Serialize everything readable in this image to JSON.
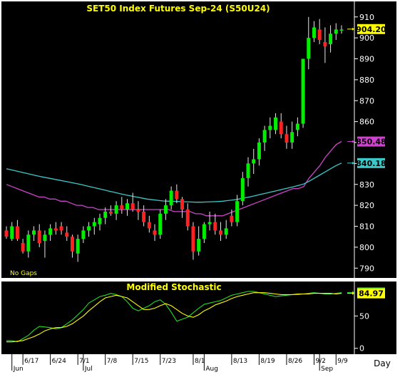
{
  "chart_data": [
    {
      "type": "candlestick",
      "title": "SET50  Index  Futures  Sep-24  (S50U24)",
      "note": "No Gaps",
      "ylim": [
        786,
        914
      ],
      "yticks": [
        790,
        800,
        810,
        820,
        830,
        840,
        850,
        860,
        870,
        880,
        890,
        900,
        910
      ],
      "last_price": {
        "value": "904.20",
        "color": "#ffff00"
      },
      "series": [
        {
          "name": "MA (magenta)",
          "color": "#cc44cc",
          "last": "850.48",
          "values": [
            830,
            829,
            828,
            827,
            826,
            825,
            824,
            824,
            823,
            823,
            822,
            822,
            821,
            820,
            820,
            819,
            819,
            818,
            818,
            818,
            818,
            818,
            818,
            818,
            818,
            818,
            818,
            818,
            818,
            818,
            818,
            817,
            817,
            817,
            817,
            816,
            816,
            815,
            815,
            815,
            815,
            816,
            817,
            818,
            819,
            820,
            821,
            822,
            823,
            824,
            825,
            826,
            827,
            828,
            828,
            829,
            833,
            836,
            839,
            843,
            846,
            849,
            850.5
          ]
        },
        {
          "name": "MA (cyan)",
          "color": "#3cc8c8",
          "last": "840.18",
          "values": [
            837.5,
            836.9,
            836.3,
            835.7,
            835.1,
            834.5,
            833.9,
            833.4,
            832.9,
            832.4,
            831.9,
            831.4,
            830.9,
            830.4,
            829.8,
            829.2,
            828.6,
            828,
            827.4,
            826.8,
            826.2,
            825.6,
            825,
            824.5,
            824,
            823.5,
            823,
            822.7,
            822.4,
            822.1,
            822,
            821.9,
            821.8,
            821.7,
            821.6,
            821.5,
            821.5,
            821.6,
            821.7,
            821.8,
            822,
            822.3,
            822.6,
            823,
            823.5,
            824,
            824.6,
            825.2,
            825.8,
            826.4,
            827,
            827.6,
            828.2,
            828.8,
            829.5,
            830.2,
            831.5,
            833,
            834.5,
            836,
            837.5,
            839,
            840.2
          ]
        }
      ],
      "candles": [
        [
          808,
          810,
          804,
          805
        ],
        [
          804,
          812,
          803,
          810
        ],
        [
          810,
          813,
          803,
          804
        ],
        [
          802,
          804,
          797,
          798
        ],
        [
          798,
          808,
          795,
          806
        ],
        [
          806,
          810,
          803,
          808
        ],
        [
          808,
          811,
          800,
          802
        ],
        [
          803,
          808,
          795,
          806
        ],
        [
          806,
          811,
          803,
          809
        ],
        [
          809,
          812,
          806,
          808
        ],
        [
          810,
          812,
          806,
          808
        ],
        [
          807,
          810,
          803,
          805
        ],
        [
          805,
          806,
          795,
          798
        ],
        [
          797,
          806,
          793,
          804
        ],
        [
          804,
          810,
          802,
          808
        ],
        [
          808,
          812,
          805,
          810
        ],
        [
          810,
          814,
          806,
          812
        ],
        [
          811,
          816,
          808,
          814
        ],
        [
          814,
          819,
          811,
          817
        ],
        [
          817,
          820,
          815,
          816
        ],
        [
          816,
          822,
          813,
          820
        ],
        [
          820,
          824,
          816,
          818
        ],
        [
          818,
          823,
          815,
          821
        ],
        [
          821,
          826,
          817,
          818
        ],
        [
          818,
          822,
          813,
          817
        ],
        [
          817,
          820,
          810,
          812
        ],
        [
          812,
          815,
          807,
          809
        ],
        [
          808,
          811,
          803,
          806
        ],
        [
          806,
          818,
          804,
          816
        ],
        [
          816,
          823,
          813,
          820
        ],
        [
          820,
          829,
          818,
          827
        ],
        [
          827,
          830,
          821,
          823
        ],
        [
          823,
          824,
          814,
          818
        ],
        [
          818,
          821,
          808,
          810
        ],
        [
          810,
          812,
          794,
          798
        ],
        [
          798,
          810,
          796,
          804
        ],
        [
          804,
          812,
          802,
          811
        ],
        [
          811,
          817,
          808,
          812
        ],
        [
          812,
          816,
          806,
          808
        ],
        [
          808,
          812,
          803,
          806
        ],
        [
          806,
          813,
          804,
          809
        ],
        [
          815,
          818,
          810,
          812
        ],
        [
          812,
          825,
          810,
          822
        ],
        [
          822,
          836,
          820,
          833
        ],
        [
          833,
          843,
          829,
          840
        ],
        [
          840,
          847,
          835,
          842
        ],
        [
          842,
          852,
          839,
          850
        ],
        [
          850,
          858,
          846,
          856
        ],
        [
          856,
          862,
          852,
          858
        ],
        [
          856,
          864,
          854,
          862
        ],
        [
          860,
          864,
          852,
          854
        ],
        [
          854,
          858,
          847,
          850
        ],
        [
          850,
          860,
          847,
          855
        ],
        [
          856,
          862,
          853,
          859
        ],
        [
          859,
          890,
          857,
          890
        ],
        [
          890,
          910,
          885,
          900
        ],
        [
          900,
          908,
          898,
          905
        ],
        [
          904,
          909,
          897,
          899
        ],
        [
          898,
          905,
          888,
          896
        ],
        [
          897,
          906,
          893,
          902
        ],
        [
          902,
          907,
          899,
          904
        ],
        [
          904,
          906,
          902,
          904
        ]
      ],
      "x_ticks": [
        "6/17",
        "6/24",
        "7/1",
        "7/8",
        "7/15",
        "7/23",
        "8/1",
        "8/13",
        "8/19",
        "8/26",
        "9/2",
        "9/9"
      ],
      "month_labels": [
        "Jun",
        "Jul",
        "Aug",
        "Sep"
      ],
      "grid": false
    },
    {
      "type": "line",
      "title": "Modified  Stochastic",
      "ylim": [
        -8,
        100
      ],
      "yticks": [
        0,
        50
      ],
      "series": [
        {
          "name": "Stochastic %K",
          "color": "#22dd22",
          "last": "86.33",
          "values": [
            12,
            12,
            10,
            15,
            20,
            28,
            34,
            33,
            32,
            30,
            32,
            38,
            44,
            52,
            60,
            70,
            75,
            80,
            82,
            85,
            83,
            80,
            72,
            62,
            58,
            62,
            66,
            72,
            75,
            68,
            56,
            42,
            45,
            48,
            55,
            62,
            68,
            70,
            72,
            74,
            78,
            82,
            84,
            86,
            88,
            88,
            86,
            84,
            82,
            80,
            81,
            82,
            83,
            83,
            84,
            85,
            86,
            85,
            84,
            84,
            85,
            86
          ]
        },
        {
          "name": "Stochastic %D",
          "color": "#ffff00",
          "last": "84.97",
          "values": [
            10,
            10,
            11,
            12,
            15,
            18,
            22,
            27,
            30,
            32,
            32,
            34,
            38,
            44,
            50,
            58,
            65,
            72,
            78,
            80,
            82,
            80,
            78,
            72,
            66,
            60,
            60,
            62,
            66,
            69,
            66,
            60,
            54,
            50,
            48,
            52,
            58,
            62,
            67,
            70,
            73,
            77,
            80,
            82,
            84,
            86,
            86,
            86,
            85,
            84,
            83,
            83,
            83,
            84,
            84,
            84,
            85,
            85,
            85,
            85,
            84,
            85
          ]
        }
      ],
      "xlabel": "Day"
    }
  ]
}
